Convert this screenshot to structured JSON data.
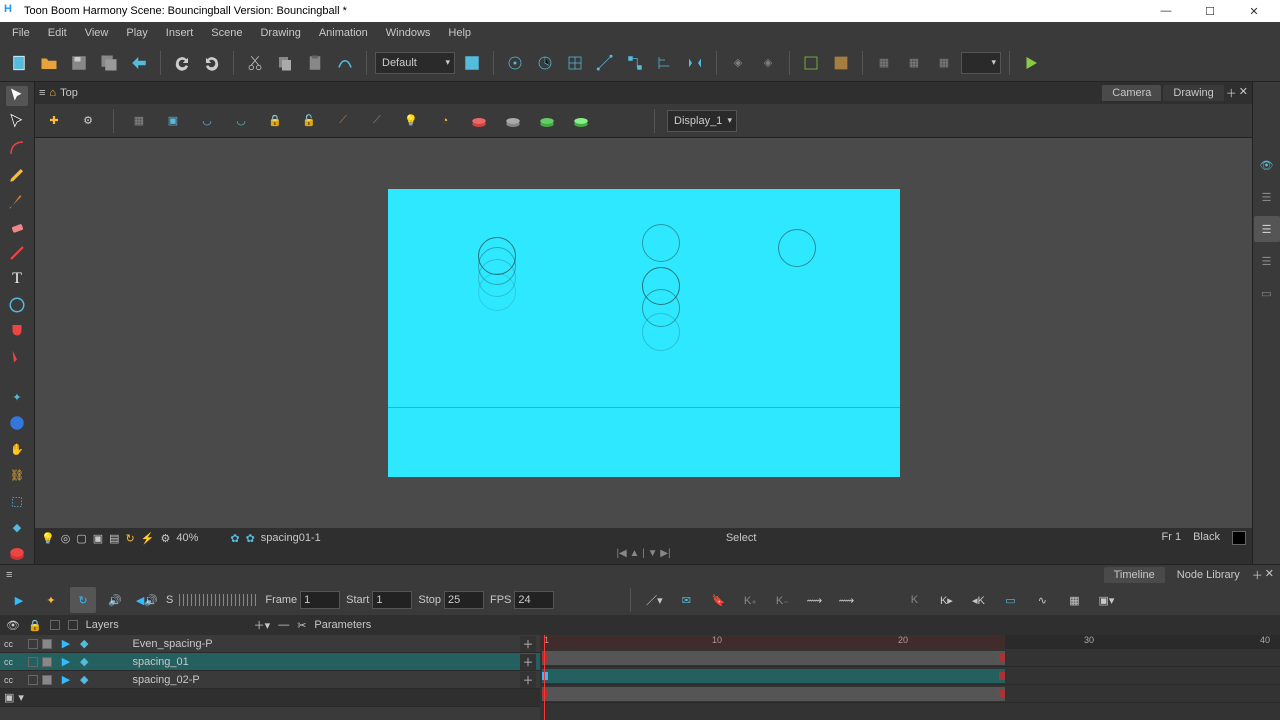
{
  "window": {
    "title": "Toon Boom Harmony  Scene: Bouncingball Version: Bouncingball *"
  },
  "menu": [
    "File",
    "Edit",
    "View",
    "Play",
    "Insert",
    "Scene",
    "Drawing",
    "Animation",
    "Windows",
    "Help"
  ],
  "toolbar": {
    "workspace_preset": "Default",
    "display": "Display_1"
  },
  "view": {
    "top_tab": "Top",
    "right_tabs": [
      "Camera",
      "Drawing"
    ]
  },
  "status": {
    "zoom": "40%",
    "drawing": "spacing01-1",
    "mode": "Select",
    "frame": "Fr 1",
    "color": "Black"
  },
  "timeline": {
    "tabs": [
      "Timeline",
      "Node Library"
    ],
    "frame": "1",
    "start": "1",
    "stop": "25",
    "fps": "24",
    "frame_label": "Frame",
    "start_label": "Start",
    "stop_label": "Stop",
    "fps_label": "FPS",
    "sound_label": "S",
    "layers_label": "Layers",
    "params_label": "Parameters",
    "ruler": [
      "1",
      "10",
      "20",
      "30",
      "40"
    ],
    "layers": [
      {
        "name": "Even_spacing-P",
        "selected": false
      },
      {
        "name": "spacing_01",
        "selected": true
      },
      {
        "name": "spacing_02-P",
        "selected": false
      }
    ]
  },
  "colors": {
    "canvas": "#2de8ff"
  }
}
